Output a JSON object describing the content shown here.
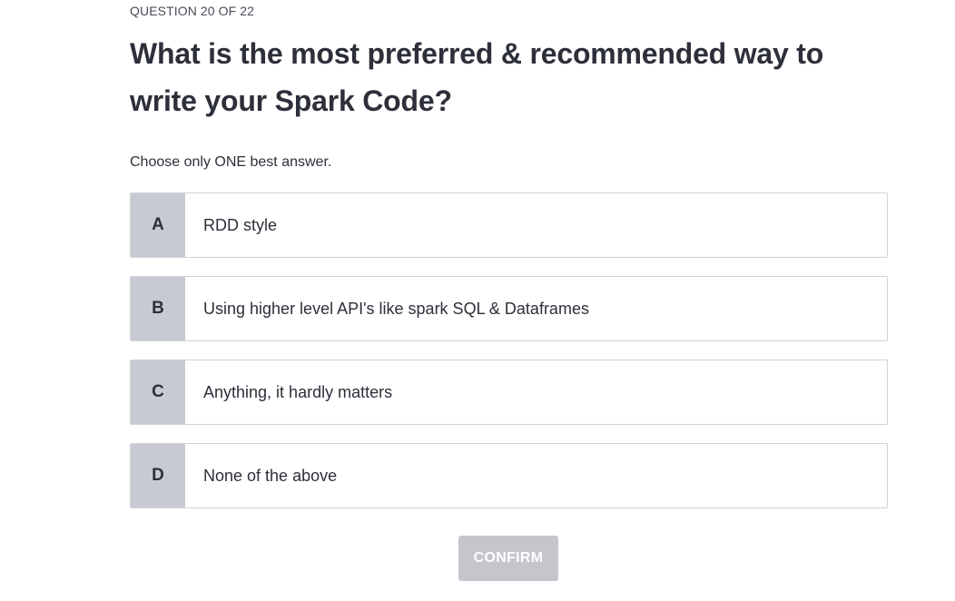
{
  "quiz": {
    "counter": "QUESTION 20 OF 22",
    "question": "What is the most preferred & recommended way to write your Spark Code?",
    "instruction": "Choose only ONE best answer.",
    "options": [
      {
        "key": "A",
        "text": "RDD style"
      },
      {
        "key": "B",
        "text": "Using higher level API's like spark SQL & Dataframes"
      },
      {
        "key": "C",
        "text": "Anything, it hardly matters"
      },
      {
        "key": "D",
        "text": "None of the above"
      }
    ],
    "confirm_label": "CONFIRM",
    "confirm_enabled": false
  },
  "colors": {
    "text": "#2d2f3a",
    "option_key_bg": "#c8cad3",
    "option_border": "#d0d2d8",
    "confirm_disabled_bg": "#c4c6cc"
  }
}
